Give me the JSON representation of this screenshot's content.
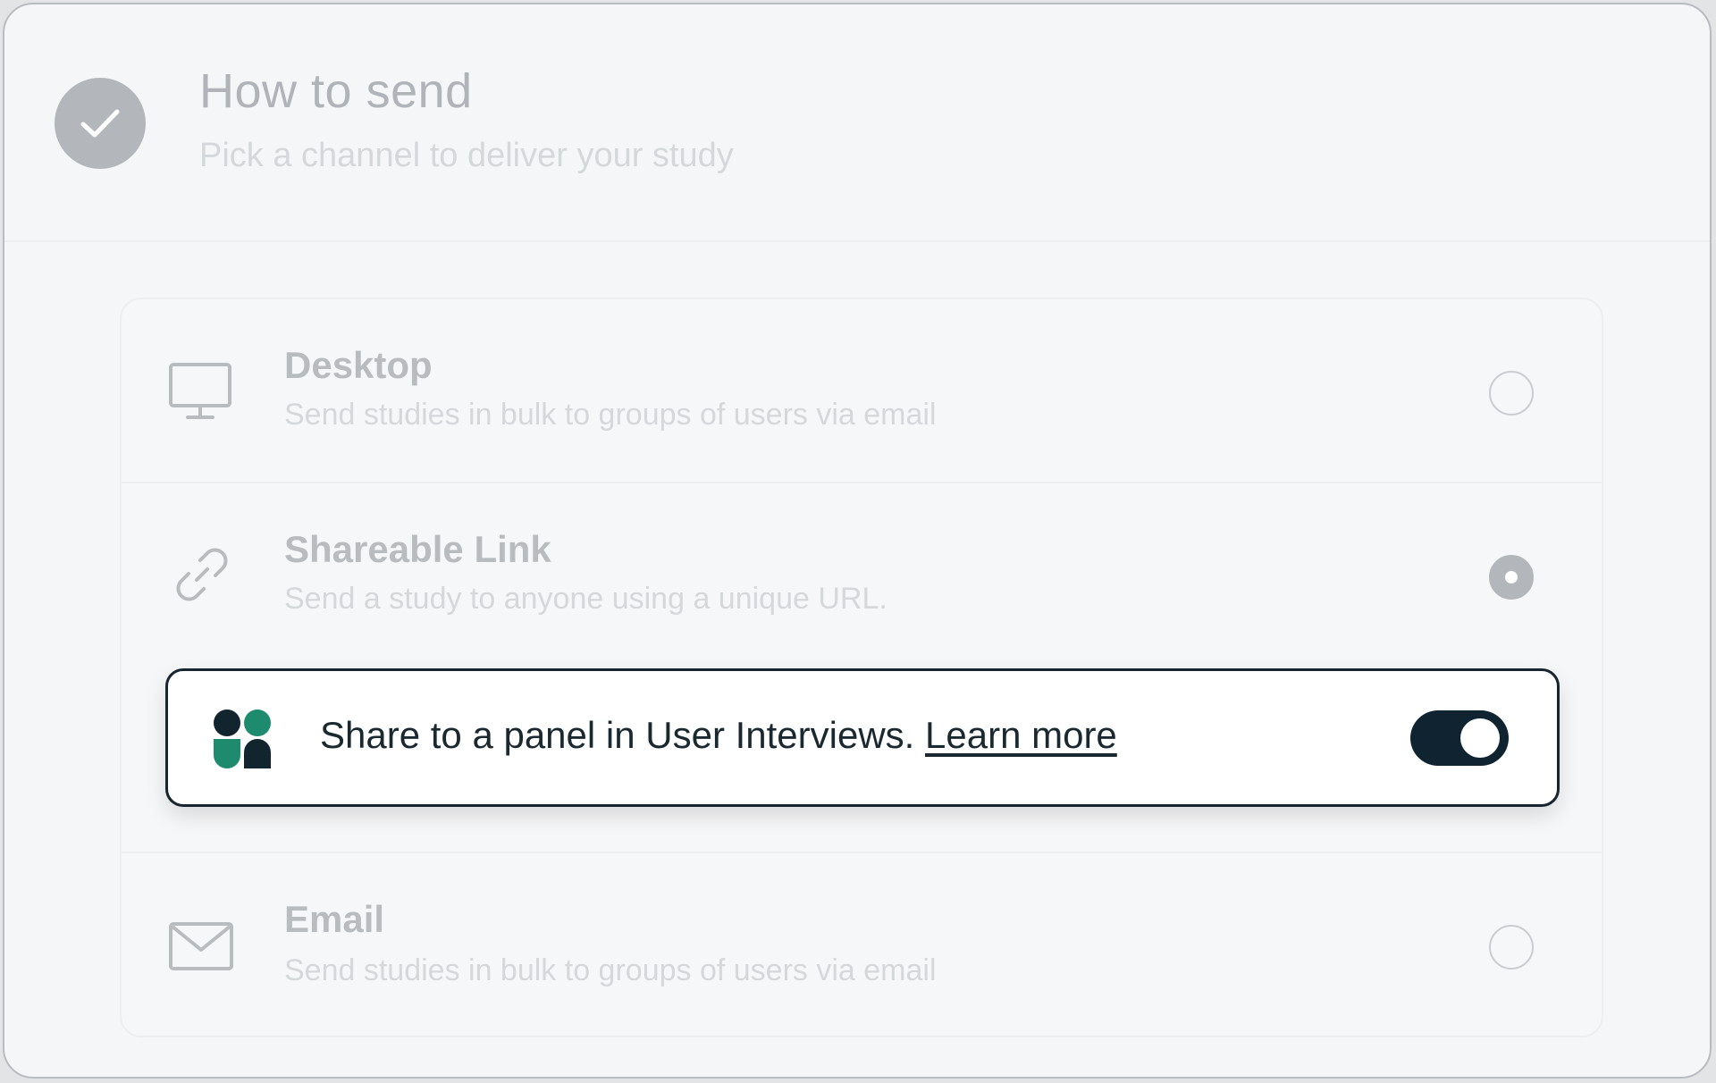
{
  "header": {
    "title": "How to send",
    "subtitle": "Pick a channel to deliver your study",
    "icon": "check-icon"
  },
  "options": [
    {
      "id": "desktop",
      "icon": "desktop-monitor-icon",
      "title": "Desktop",
      "description": "Send studies in bulk to groups of users via email",
      "selected": false
    },
    {
      "id": "shareable-link",
      "icon": "link-icon",
      "title": "Shareable Link",
      "description": "Send a study to anyone using a unique URL.",
      "selected": true
    },
    {
      "id": "email",
      "icon": "envelope-icon",
      "title": "Email",
      "description": "Send studies in bulk to groups of users via email",
      "selected": false
    }
  ],
  "panel_share": {
    "text": "Share to a panel in User Interviews.",
    "link_label": "Learn more",
    "toggle_on": true,
    "logo_icon": "user-interviews-logo-icon"
  },
  "colors": {
    "toggle_on": "#0f2430",
    "logo_dark": "#12242e",
    "logo_green": "#1e8a6e",
    "panel_border": "#16252f"
  }
}
